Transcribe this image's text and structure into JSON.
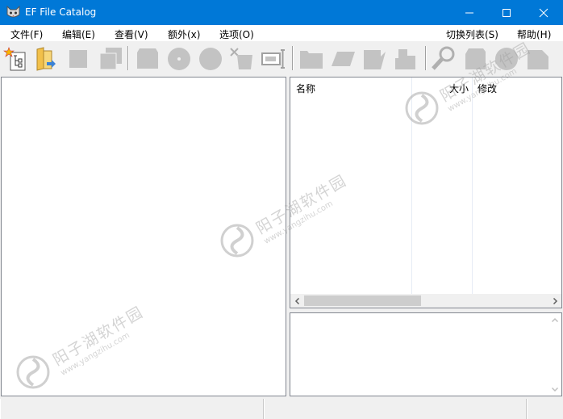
{
  "window": {
    "title": "EF File Catalog"
  },
  "menu": {
    "file": "文件(F)",
    "edit": "编辑(E)",
    "view": "查看(V)",
    "extra": "额外(x)",
    "options": "选项(O)",
    "switch_list": "切换列表(S)",
    "help": "帮助(H)"
  },
  "toolbar": {
    "icons": [
      "new-catalog-icon",
      "open-folder-icon",
      "square-icon",
      "stack-icon",
      "frame-icon",
      "disc-icon",
      "circle-icon",
      "scissors-icon",
      "card-icon",
      "folder-icon",
      "slanted-card-icon",
      "tag-icon",
      "puzzle-icon",
      "search-icon",
      "doc-icon",
      "pie-icon",
      "page-icon"
    ]
  },
  "file_list": {
    "columns": [
      "名称",
      "大小",
      "修改"
    ]
  },
  "watermark": {
    "cn": "阳子湖软件园",
    "en": "www.yangzihu.com"
  },
  "colors": {
    "titlebar": "#0078d7",
    "toolbar_icon_gray": "#c3c3c3",
    "window_bg": "#f0f0f0"
  }
}
